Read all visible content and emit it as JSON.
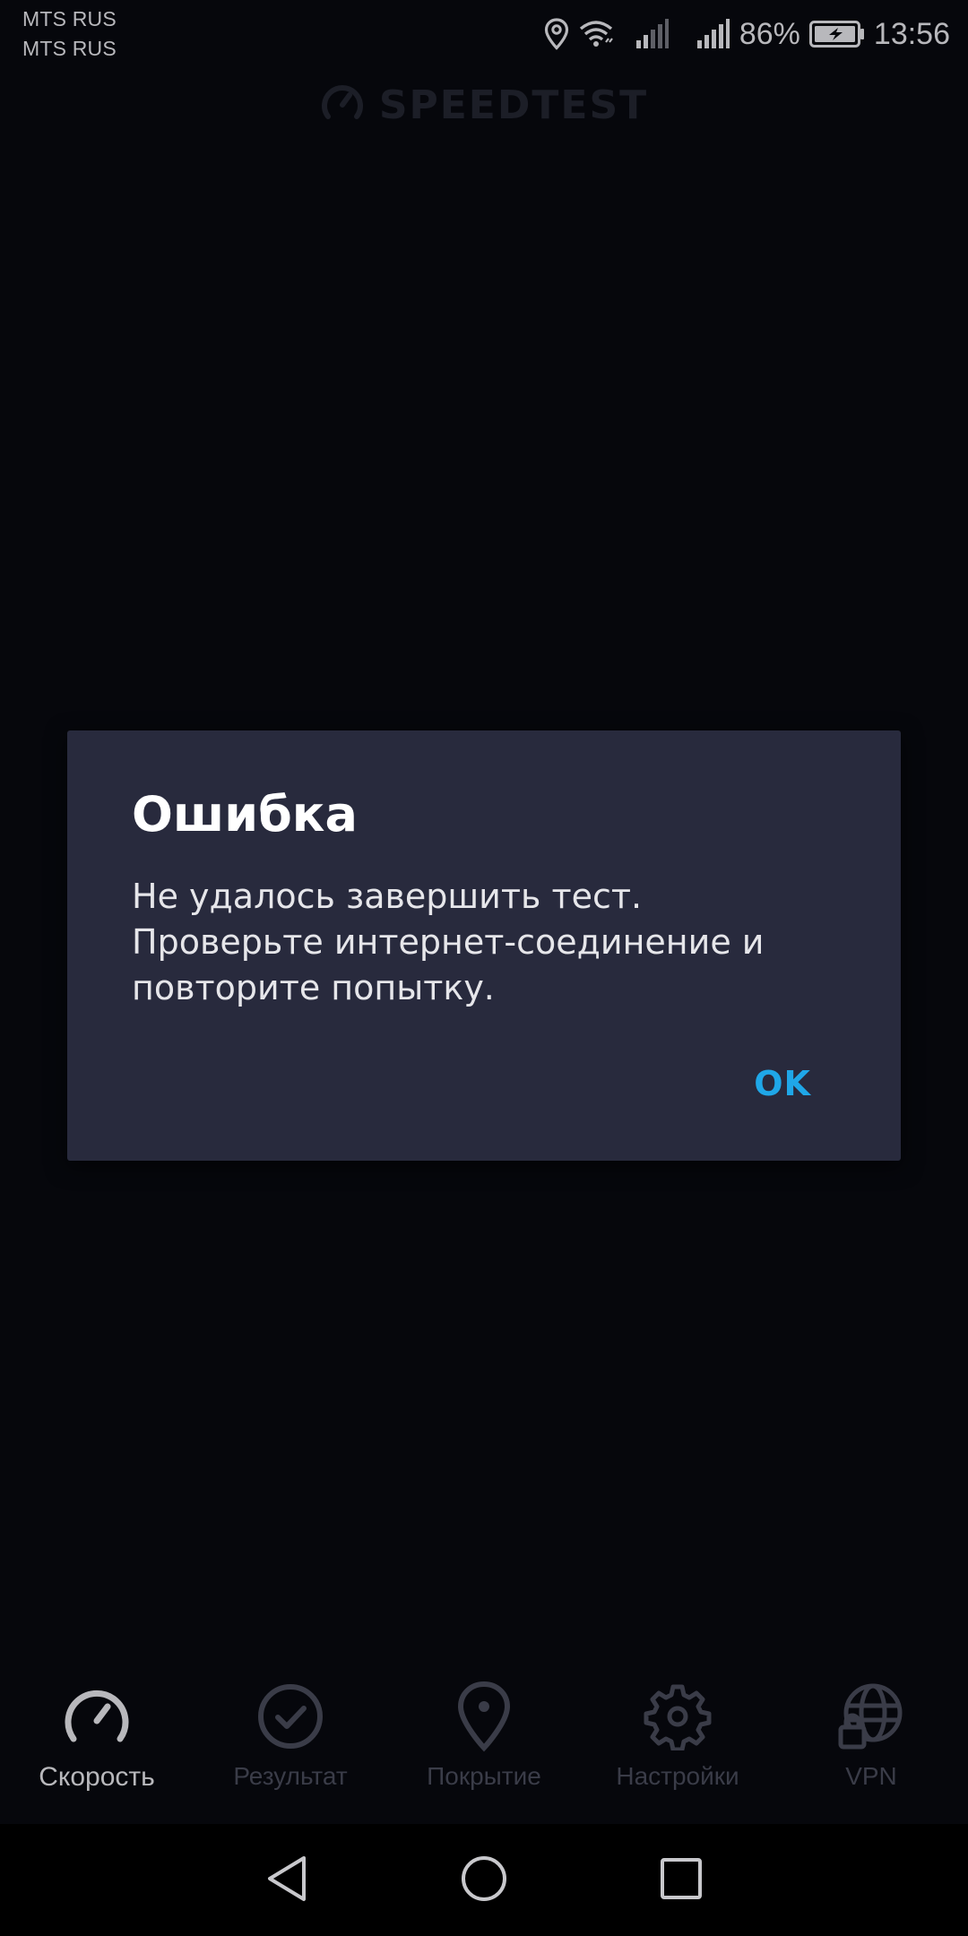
{
  "status_bar": {
    "carrier_1": "MTS RUS",
    "carrier_2": "MTS RUS",
    "battery_percent": "86%",
    "time": "13:56",
    "icons": [
      "location-icon",
      "wifi-icon",
      "signal-icon",
      "signal-icon",
      "battery-icon"
    ]
  },
  "header": {
    "title": "SPEEDTEST",
    "icon": "speedometer-icon"
  },
  "dialog": {
    "title": "Ошибка",
    "message_lines": [
      "Не удалось завершить тест.",
      "Проверьте интернет-соединение и",
      "повторите попытку."
    ],
    "ok_label": "OK"
  },
  "bottom_nav": {
    "items": [
      {
        "label": "Скорость",
        "icon": "speedometer-icon",
        "active": true
      },
      {
        "label": "Результат",
        "icon": "check-circle-icon",
        "active": false
      },
      {
        "label": "Покрытие",
        "icon": "map-pin-icon",
        "active": false
      },
      {
        "label": "Настройки",
        "icon": "gear-icon",
        "active": false
      },
      {
        "label": "VPN",
        "icon": "globe-lock-icon",
        "active": false
      }
    ]
  },
  "system_nav": {
    "icons": [
      "back-icon",
      "home-icon",
      "recents-icon"
    ]
  },
  "colors": {
    "background": "#06070c",
    "dialog_background": "#282a3d",
    "accent": "#1fa7e8",
    "inactive": "#3a3c48"
  }
}
